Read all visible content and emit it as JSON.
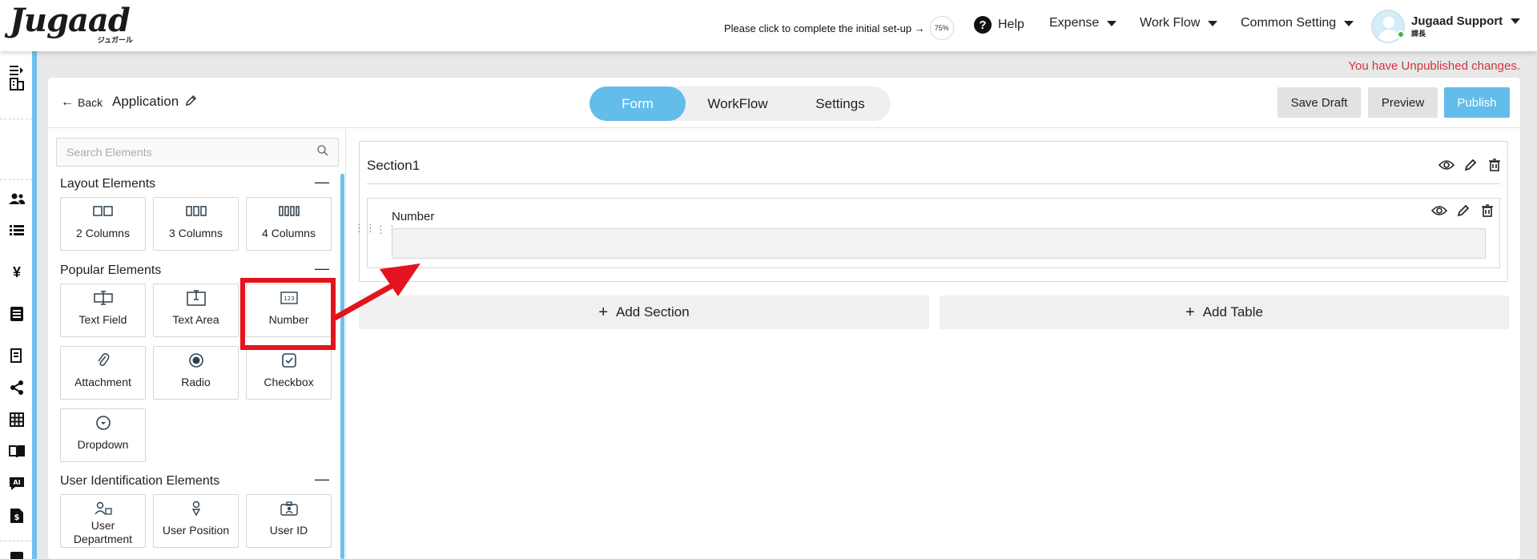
{
  "topnav": {
    "logo_text": "Jugaad",
    "logo_sub": "ジュガール",
    "setup_text": "Please click to complete the initial set-up →",
    "setup_progress": "75%",
    "help_label": "Help",
    "menus": [
      "Expense",
      "Work Flow",
      "Common Setting"
    ],
    "user_name": "Jugaad Support",
    "user_role": "課長"
  },
  "unpublished_notice": "You have Unpublished changes.",
  "header": {
    "back_label": "Back",
    "app_title": "Application",
    "tabs": [
      "Form",
      "WorkFlow",
      "Settings"
    ],
    "active_tab": "Form",
    "save_draft_label": "Save Draft",
    "preview_label": "Preview",
    "publish_label": "Publish"
  },
  "sidebar": {
    "search_placeholder": "Search Elements",
    "layout_title": "Layout Elements",
    "layout_items": [
      "2 Columns",
      "3 Columns",
      "4 Columns"
    ],
    "popular_title": "Popular Elements",
    "popular_items": [
      "Text Field",
      "Text Area",
      "Number",
      "Attachment",
      "Radio",
      "Checkbox",
      "Dropdown"
    ],
    "user_title": "User Identification Elements",
    "user_items": [
      "User Department",
      "User Position",
      "User ID"
    ]
  },
  "form": {
    "section_title": "Section1",
    "field_label": "Number",
    "add_section_label": "Add Section",
    "add_table_label": "Add Table"
  },
  "colors": {
    "accent": "#63bdeb",
    "rail": "#6ec1ee",
    "warning_text": "#d0343c",
    "highlight": "#e3141e"
  }
}
